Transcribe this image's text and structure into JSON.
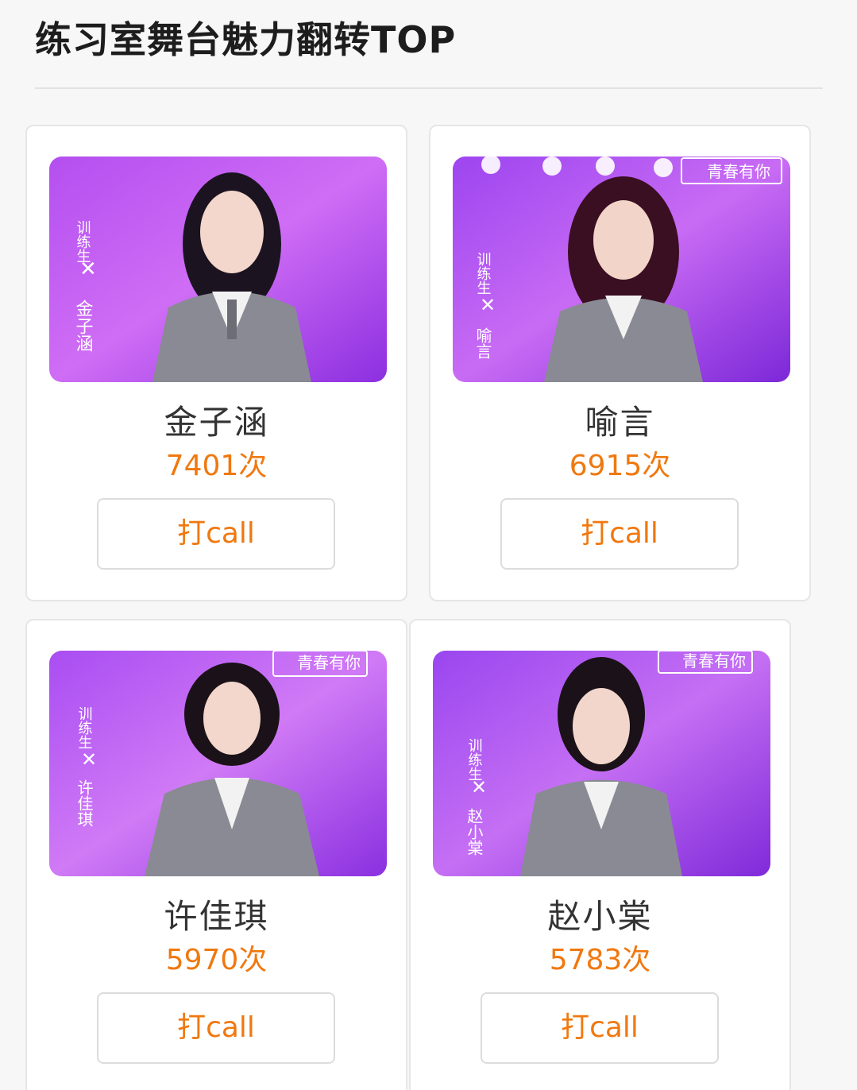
{
  "page": {
    "title": "练习室舞台魅力翻转TOP"
  },
  "colors": {
    "accent": "#f0780f",
    "title": "#1d1d1d",
    "name": "#333333",
    "card_border": "#e6e6e6",
    "photo_bg_start": "#c65cf0",
    "photo_bg_end": "#8a2be2"
  },
  "trainees": [
    {
      "name": "金子涵",
      "count": "7401次",
      "button_label": "打call",
      "photo_caption": "训练生 X 金子涵"
    },
    {
      "name": "喻言",
      "count": "6915次",
      "button_label": "打call",
      "photo_caption": "训练生 X 喻言",
      "photo_logo": "青春有你"
    },
    {
      "name": "许佳琪",
      "count": "5970次",
      "button_label": "打call",
      "photo_caption": "训练生 X 许佳琪",
      "photo_logo": "青春有你"
    },
    {
      "name": "赵小棠",
      "count": "5783次",
      "button_label": "打call",
      "photo_caption": "训练生 X 赵小棠",
      "photo_logo": "青春有你"
    }
  ]
}
